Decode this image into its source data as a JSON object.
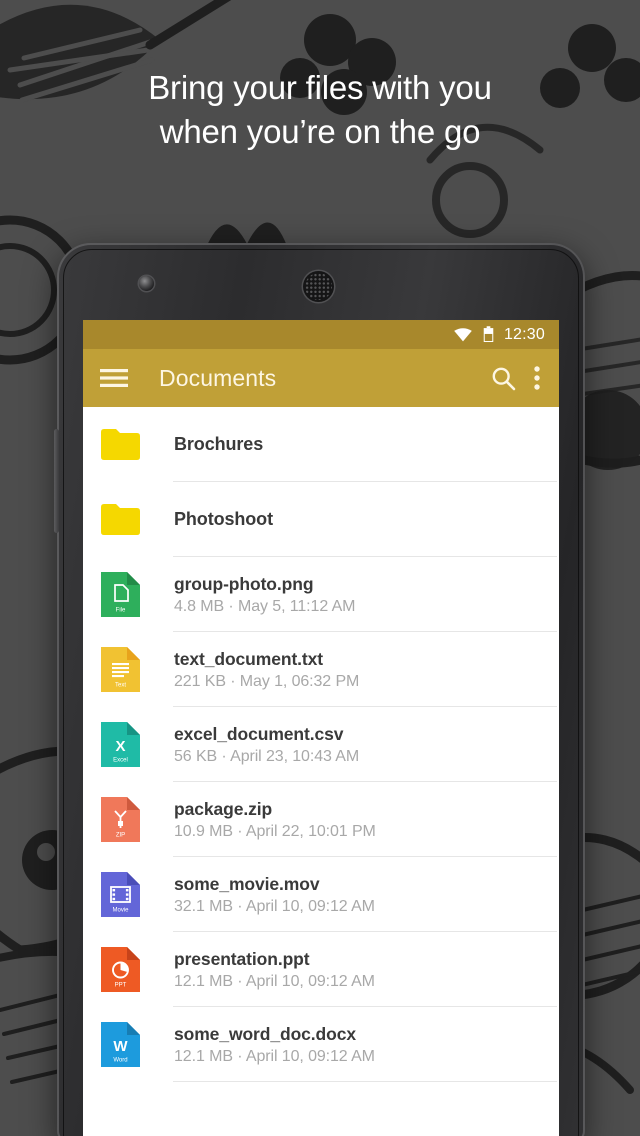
{
  "headline": {
    "line1": "Bring your files with you",
    "line2": "when you’re on the go"
  },
  "colors": {
    "background": "#4d4d4d",
    "statusbar": "#a8882c",
    "appbar": "#c0a037",
    "appbar_text": "#fdf6e3",
    "folder": "#f5d800",
    "file_name": "#3a3a3a",
    "file_meta": "#a8a8a8",
    "divider": "#e6e6e6"
  },
  "statusbar": {
    "wifi_icon": "wifi-icon",
    "battery_icon": "battery-icon",
    "time": "12:30"
  },
  "appbar": {
    "menu_icon": "hamburger-menu-icon",
    "title": "Documents",
    "search_icon": "search-icon",
    "overflow_icon": "overflow-menu-icon"
  },
  "list": {
    "items": [
      {
        "type": "folder",
        "icon": "folder-icon",
        "name": "Brochures",
        "meta": "",
        "color": "#f5d800",
        "label": ""
      },
      {
        "type": "folder",
        "icon": "folder-icon",
        "name": "Photoshoot",
        "meta": "",
        "color": "#f5d800",
        "label": ""
      },
      {
        "type": "file",
        "icon": "file-icon",
        "name": "group-photo.png",
        "meta": "4.8 MB · May 5, 11:12 AM",
        "color": "#2eaf5c",
        "label": "File"
      },
      {
        "type": "file",
        "icon": "text-icon",
        "name": "text_document.txt",
        "meta": "221 KB · May 1, 06:32 PM",
        "color": "#f1c232",
        "label": "Text"
      },
      {
        "type": "file",
        "icon": "excel-icon",
        "name": "excel_document.csv",
        "meta": "56 KB · April 23, 10:43 AM",
        "color": "#1fbba6",
        "label": "Excel"
      },
      {
        "type": "file",
        "icon": "zip-icon",
        "name": "package.zip",
        "meta": "10.9 MB · April 22, 10:01 PM",
        "color": "#f0785a",
        "label": "ZIP"
      },
      {
        "type": "file",
        "icon": "movie-icon",
        "name": "some_movie.mov",
        "meta": "32.1 MB · April 10, 09:12 AM",
        "color": "#6366d8",
        "label": "Movie"
      },
      {
        "type": "file",
        "icon": "ppt-icon",
        "name": "presentation.ppt",
        "meta": "12.1 MB · April 10, 09:12 AM",
        "color": "#ee5a24",
        "label": "PPT"
      },
      {
        "type": "file",
        "icon": "word-icon",
        "name": "some_word_doc.docx",
        "meta": "12.1 MB · April 10, 09:12 AM",
        "color": "#1d9bdd",
        "label": "Word"
      }
    ]
  },
  "device": {
    "camera_icon": "front-camera-icon",
    "speaker_icon": "earpiece-speaker-icon",
    "volume_button": "volume-button"
  }
}
